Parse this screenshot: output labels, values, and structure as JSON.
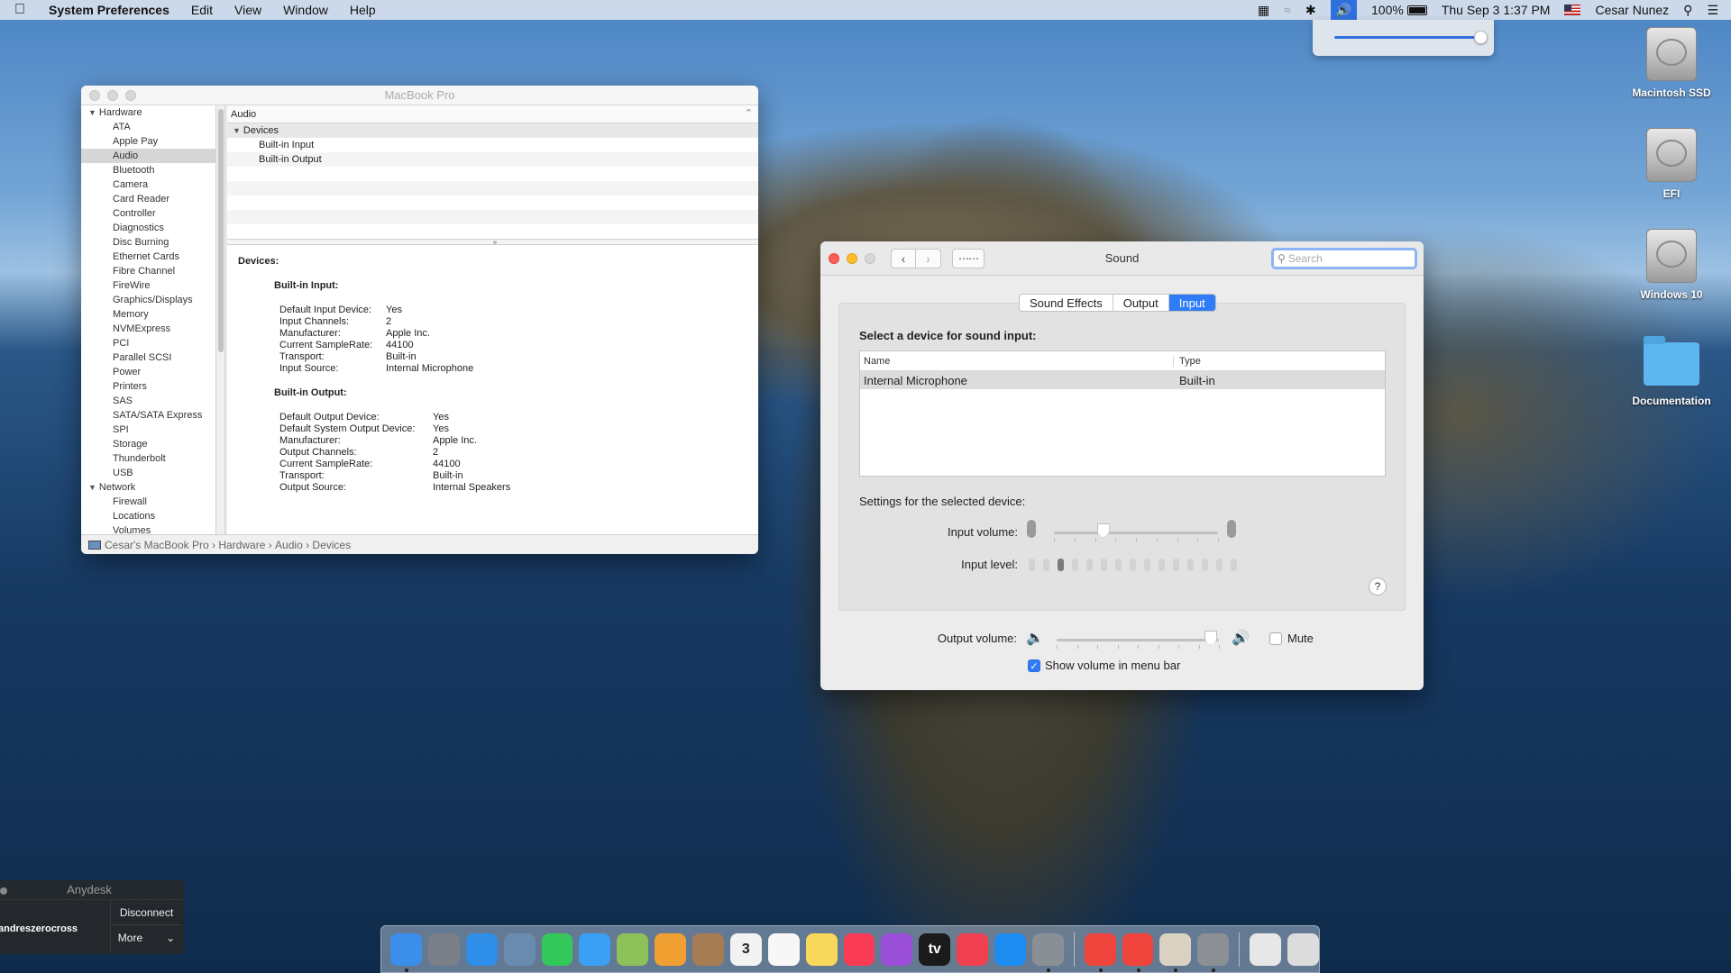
{
  "menubar": {
    "app_name": "System Preferences",
    "menus": [
      "Edit",
      "View",
      "Window",
      "Help"
    ],
    "battery": "100%",
    "datetime": "Thu Sep 3  1:37 PM",
    "user": "Cesar Nunez",
    "accent": "#2f6fde"
  },
  "volume_popup": {
    "level": 0.95
  },
  "desktop_icons": [
    {
      "label": "Macintosh SSD",
      "icon": "disk-icon"
    },
    {
      "label": "EFI",
      "icon": "disk-icon"
    },
    {
      "label": "Windows 10",
      "icon": "disk-icon"
    },
    {
      "label": "Documentation",
      "icon": "folder-icon"
    }
  ],
  "sysinfo": {
    "title": "MacBook Pro",
    "sidebar": {
      "hardware_label": "Hardware",
      "hardware_items": [
        "ATA",
        "Apple Pay",
        "Audio",
        "Bluetooth",
        "Camera",
        "Card Reader",
        "Controller",
        "Diagnostics",
        "Disc Burning",
        "Ethernet Cards",
        "Fibre Channel",
        "FireWire",
        "Graphics/Displays",
        "Memory",
        "NVMExpress",
        "PCI",
        "Parallel SCSI",
        "Power",
        "Printers",
        "SAS",
        "SATA/SATA Express",
        "SPI",
        "Storage",
        "Thunderbolt",
        "USB"
      ],
      "selected": "Audio",
      "network_label": "Network",
      "network_items": [
        "Firewall",
        "Locations",
        "Volumes"
      ]
    },
    "main_header": "Audio",
    "tree": {
      "group": "Devices",
      "children": [
        "Built-in Input",
        "Built-in Output"
      ]
    },
    "detail": {
      "heading": "Devices:",
      "input_title": "Built-in Input:",
      "input_rows": [
        {
          "k": "Default Input Device:",
          "v": "Yes"
        },
        {
          "k": "Input Channels:",
          "v": "2"
        },
        {
          "k": "Manufacturer:",
          "v": "Apple Inc."
        },
        {
          "k": "Current SampleRate:",
          "v": "44100"
        },
        {
          "k": "Transport:",
          "v": "Built-in"
        },
        {
          "k": "Input Source:",
          "v": "Internal Microphone"
        }
      ],
      "output_title": "Built-in Output:",
      "output_rows": [
        {
          "k": "Default Output Device:",
          "v": "Yes"
        },
        {
          "k": "Default System Output Device:",
          "v": "Yes"
        },
        {
          "k": "Manufacturer:",
          "v": "Apple Inc."
        },
        {
          "k": "Output Channels:",
          "v": "2"
        },
        {
          "k": "Current SampleRate:",
          "v": "44100"
        },
        {
          "k": "Transport:",
          "v": "Built-in"
        },
        {
          "k": "Output Source:",
          "v": "Internal Speakers"
        }
      ]
    },
    "breadcrumb": [
      "Cesar's MacBook Pro",
      "Hardware",
      "Audio",
      "Devices"
    ]
  },
  "sound": {
    "title": "Sound",
    "search_placeholder": "Search",
    "tabs": [
      "Sound Effects",
      "Output",
      "Input"
    ],
    "active_tab": "Input",
    "select_label": "Select a device for sound input:",
    "col_name": "Name",
    "col_type": "Type",
    "device_name": "Internal Microphone",
    "device_type": "Built-in",
    "settings_label": "Settings for the selected device:",
    "input_volume_label": "Input volume:",
    "input_volume": 0.3,
    "input_level_label": "Input level:",
    "input_level_bars": 15,
    "input_level_on": 3,
    "output_volume_label": "Output volume:",
    "output_volume": 0.95,
    "mute_label": "Mute",
    "mute_checked": false,
    "show_volume_label": "Show volume in menu bar",
    "show_volume_checked": true,
    "help": "?"
  },
  "anydesk": {
    "title": "Anydesk",
    "user": "andreszerocross",
    "disconnect": "Disconnect",
    "more": "More"
  },
  "dock": {
    "items": [
      {
        "icon": "finder-icon",
        "color": "#3b8eea",
        "running": true
      },
      {
        "icon": "launchpad-icon",
        "color": "#7a7f88",
        "running": false
      },
      {
        "icon": "safari-icon",
        "color": "#2f8ee8",
        "running": false
      },
      {
        "icon": "preview-icon",
        "color": "#6a8bb0",
        "running": false
      },
      {
        "icon": "facetime-icon",
        "color": "#34c759",
        "running": false
      },
      {
        "icon": "messages-icon",
        "color": "#3aa0f5",
        "running": false
      },
      {
        "icon": "maps-icon",
        "color": "#8cc15a",
        "running": false
      },
      {
        "icon": "photos-icon",
        "color": "#f0a030",
        "running": false
      },
      {
        "icon": "contacts-icon",
        "color": "#a67c52",
        "running": false
      },
      {
        "icon": "calendar-icon",
        "color": "#f2f2f2",
        "running": false,
        "label": "3"
      },
      {
        "icon": "reminders-icon",
        "color": "#f7f7f7",
        "running": false
      },
      {
        "icon": "notes-icon",
        "color": "#f7d85a",
        "running": false
      },
      {
        "icon": "music-icon",
        "color": "#fa3b55",
        "running": false
      },
      {
        "icon": "podcasts-icon",
        "color": "#9b4fd8",
        "running": false
      },
      {
        "icon": "tv-icon",
        "color": "#1b1b1b",
        "running": false,
        "label": "tv"
      },
      {
        "icon": "news-icon",
        "color": "#f04050",
        "running": false
      },
      {
        "icon": "appstore-icon",
        "color": "#1d8cf0",
        "running": false
      },
      {
        "icon": "system-preferences-icon",
        "color": "#8a8f96",
        "running": true
      },
      {
        "sep": true
      },
      {
        "icon": "anydesk-icon",
        "color": "#ef443b",
        "running": true
      },
      {
        "icon": "anydesk-icon-2",
        "color": "#ef443b",
        "running": true
      },
      {
        "icon": "script-editor-icon",
        "color": "#d9d2c2",
        "running": true
      },
      {
        "icon": "system-information-icon",
        "color": "#8c8f94",
        "running": true
      },
      {
        "sep": true
      },
      {
        "icon": "document-icon",
        "color": "#e7e7e7",
        "running": false
      },
      {
        "icon": "trash-icon",
        "color": "#dcdcdc",
        "running": false
      }
    ]
  }
}
